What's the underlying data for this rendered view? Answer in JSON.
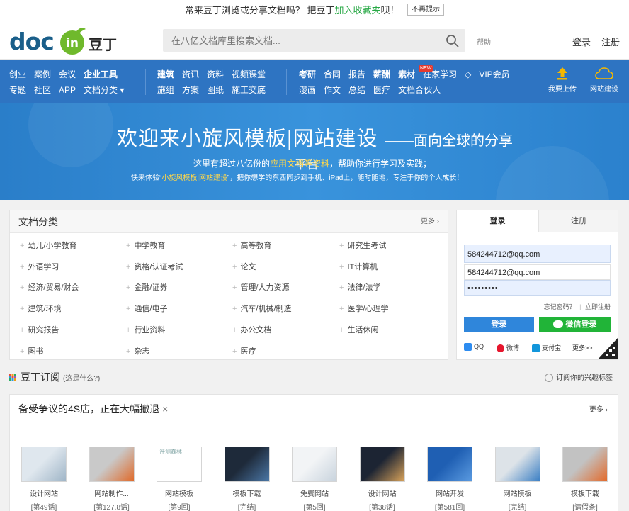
{
  "notice": {
    "text_before": "常来豆丁浏览或分享文档吗？ 把豆丁",
    "fav_link": "加入收藏夹",
    "text_after": "呗！",
    "dismiss": "不再提示"
  },
  "header": {
    "logo_doc": "doc",
    "logo_in": "in",
    "logo_cn": "豆丁",
    "search_placeholder": "在八亿文档库里搜索文档...",
    "help": "帮助",
    "login": "登录",
    "register": "注册"
  },
  "nav": {
    "group1_row1": [
      "创业",
      "案例",
      "会议",
      "企业工具"
    ],
    "group1_row2": [
      "专题",
      "社区",
      "APP",
      "文档分类 ▾"
    ],
    "group2_row1": [
      "建筑",
      "资讯",
      "资料",
      "视频课堂"
    ],
    "group2_row2": [
      "施组",
      "方案",
      "图纸",
      "施工交底"
    ],
    "group3_row1": [
      "考研",
      "合同",
      "报告",
      "薪酬",
      "素材",
      "在家学习",
      "VIP会员"
    ],
    "group3_row2": [
      "漫画",
      "作文",
      "总结",
      "医疗",
      "文档合伙人"
    ],
    "new_badge": "NEW",
    "upload": "我要上传",
    "build": "网站建设"
  },
  "banner": {
    "title": "欢迎来小旋风模板|网站建设",
    "subtitle": "——面向全球的分享",
    "overflow": "平台",
    "line1_pre": "这里有超过八亿份的",
    "line1_hl": "应用文档等资料",
    "line1_post": "，帮助你进行学习及实践；",
    "line2_pre": "快来体验“",
    "line2_hl": "小旋风模板|网站建设",
    "line2_post": "”，把你想学的东西同步到手机、iPad上，随时随地，专注于你的个人成长！"
  },
  "categories": {
    "title": "文档分类",
    "more": "更多 ›",
    "items": [
      "幼儿/小学教育",
      "中学教育",
      "高等教育",
      "研究生考试",
      "外语学习",
      "资格/认证考试",
      "论文",
      "IT计算机",
      "经济/贸易/财会",
      "金融/证券",
      "管理/人力资源",
      "法律/法学",
      "建筑/环境",
      "通信/电子",
      "汽车/机械/制造",
      "医学/心理学",
      "研究报告",
      "行业资料",
      "办公文档",
      "生活休闲",
      "图书",
      "杂志",
      "医疗"
    ]
  },
  "login": {
    "tab_login": "登录",
    "tab_register": "注册",
    "autofill": "584244712@qq.com",
    "username": "584244712@qq.com",
    "password": "•••••••••",
    "forgot": "忘记密码？",
    "sep": "|",
    "register_now": "立即注册",
    "login_btn": "登录",
    "wechat_btn": "微信登录",
    "qq": "QQ",
    "weibo": "微博",
    "alipay": "支付宝",
    "more": "更多>>"
  },
  "subscribe": {
    "title": "豆丁订阅",
    "whatis": "(这是什么?)",
    "follow": "订阅你的兴趣标签"
  },
  "feed": {
    "title": "备受争议的4S店，正在大幅撤退",
    "close": "×",
    "more": "更多 ›",
    "docs": [
      {
        "name": "设计网站",
        "count": "[第49话]"
      },
      {
        "name": "网站制作...",
        "count": "[第127.8话]"
      },
      {
        "name": "网站模板",
        "count": "[第9回]"
      },
      {
        "name": "模板下载",
        "count": "[完结]"
      },
      {
        "name": "免费网站",
        "count": "[第5回]"
      },
      {
        "name": "设计网站",
        "count": "[第38话]"
      },
      {
        "name": "网站开发",
        "count": "[第581回]"
      },
      {
        "name": "网站模板",
        "count": "[完结]"
      },
      {
        "name": "模板下载",
        "count": "[请假条]"
      }
    ],
    "broken_img_alt": "评测森林"
  },
  "colors": {
    "brand_blue": "#2e74c2",
    "logo_green": "#6fb92c",
    "login_blue": "#2f86db",
    "wechat_green": "#21b438"
  }
}
